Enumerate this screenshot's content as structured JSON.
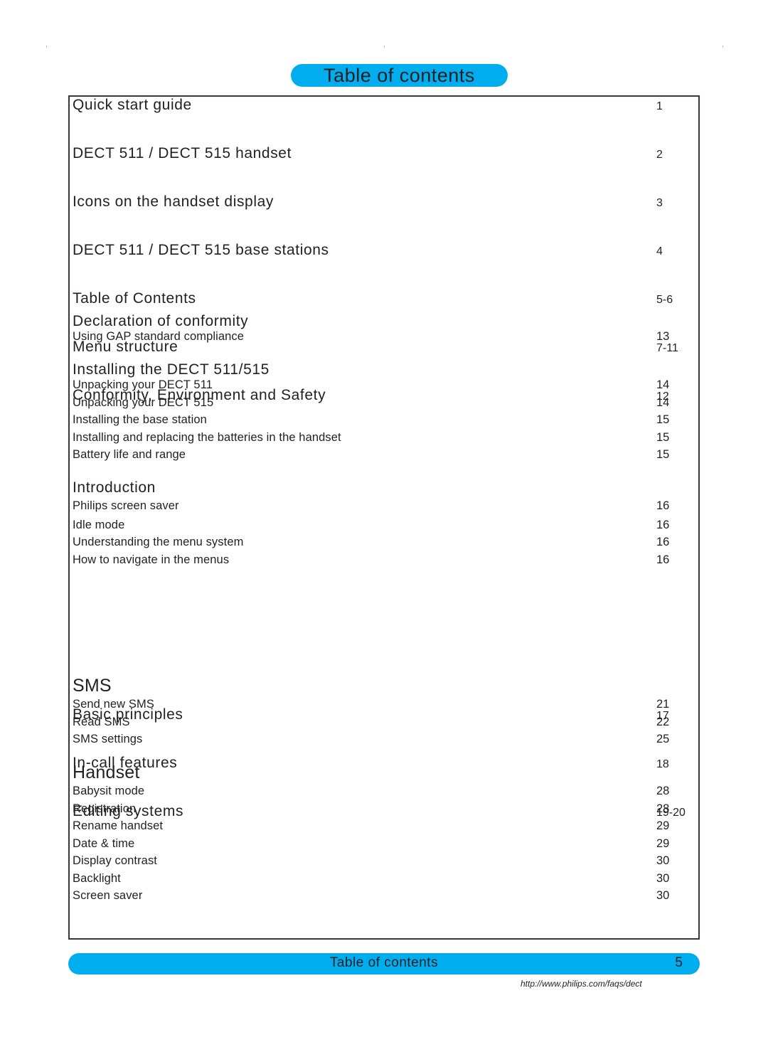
{
  "page_title": "Table of contents",
  "major_entries": [
    {
      "label": "Quick start guide",
      "page": "1"
    },
    {
      "label": "DECT 511 / DECT 515 handset",
      "page": "2"
    },
    {
      "label": "Icons on the handset display",
      "page": "3"
    },
    {
      "label": "DECT 511 / DECT 515 base stations",
      "page": "4"
    },
    {
      "label": "Table of Contents",
      "page": "5-6"
    },
    {
      "label": "Menu structure",
      "page": "7-11"
    },
    {
      "label": "Conformity, Environment and Safety",
      "page": "12"
    }
  ],
  "sections": {
    "declaration": {
      "heading": "Declaration of conformity",
      "items": [
        {
          "label": "Using GAP standard compliance",
          "page": "13"
        }
      ]
    },
    "installing": {
      "heading": "Installing the DECT 511/515",
      "items": [
        {
          "label": "Unpacking your DECT 511",
          "page": "14"
        },
        {
          "label": "Unpacking your DECT 515",
          "page": "14"
        },
        {
          "label": "Installing the base station",
          "page": "15"
        },
        {
          "label": "Installing and replacing the batteries in the handset",
          "page": "15"
        },
        {
          "label": "Battery life and range",
          "page": "15"
        }
      ]
    },
    "introduction": {
      "heading": "Introduction",
      "items": [
        {
          "label": "Philips screen saver",
          "page": "16"
        },
        {
          "label": "Idle mode",
          "page": "16"
        },
        {
          "label": "Understanding the menu system",
          "page": "16"
        },
        {
          "label": "How to navigate in the menus",
          "page": "16"
        }
      ]
    }
  },
  "major_entries_2": [
    {
      "label": "Basic principles",
      "page": "17"
    },
    {
      "label": "In-call features",
      "page": "18"
    },
    {
      "label": "Editing systems",
      "page": "19-20"
    }
  ],
  "sections_2": {
    "sms": {
      "heading": "SMS",
      "items": [
        {
          "label": "Send new SMS",
          "page": "21"
        },
        {
          "label": "Read SMS",
          "page": "22"
        },
        {
          "label": "SMS settings",
          "page": "25"
        }
      ]
    },
    "handset": {
      "heading": "Handset",
      "items": [
        {
          "label": "Babysit mode",
          "page": "28"
        },
        {
          "label": "Registration",
          "page": "28"
        },
        {
          "label": "Rename handset",
          "page": "29"
        },
        {
          "label": "Date & time",
          "page": "29"
        },
        {
          "label": "Display contrast",
          "page": "30"
        },
        {
          "label": "Backlight",
          "page": "30"
        },
        {
          "label": "Screen saver",
          "page": "30"
        }
      ]
    }
  },
  "footer": {
    "section_title": "Table of contents",
    "page_number": "5",
    "url": "http://www.philips.com/faqs/dect"
  },
  "colors": {
    "accent": "#00aeef",
    "text": "#231f20",
    "border": "#3a3536"
  }
}
